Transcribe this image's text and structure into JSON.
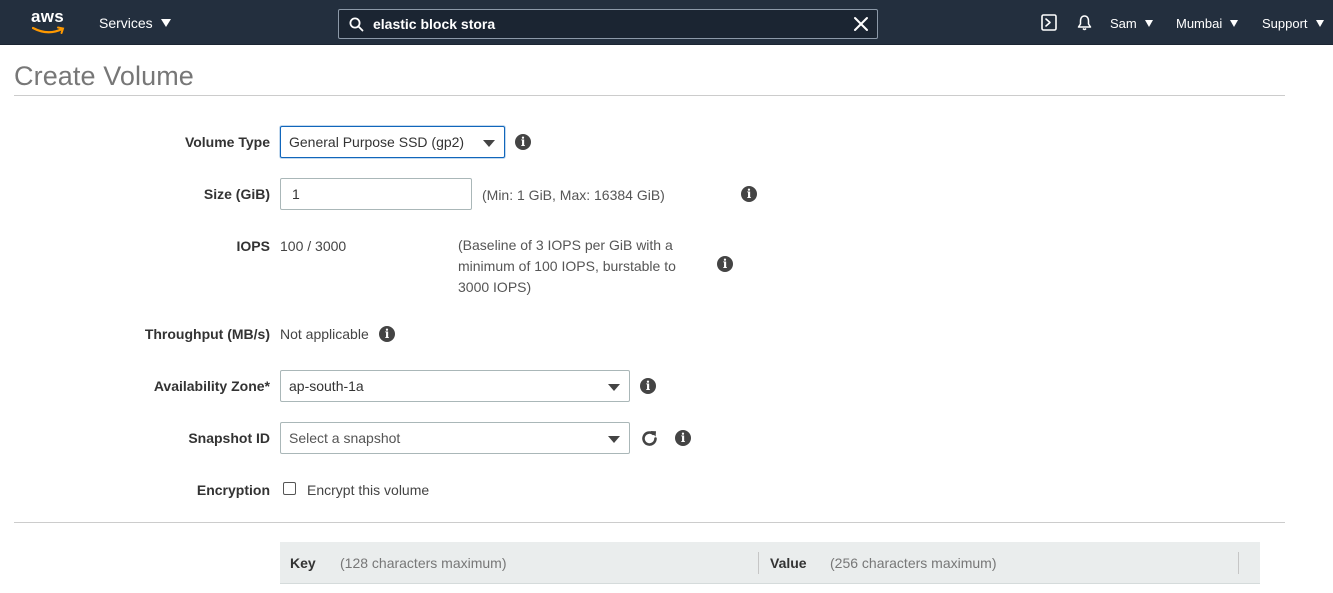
{
  "nav": {
    "logo_text": "aws",
    "services_label": "Services",
    "search": {
      "value": "elastic block stora",
      "placeholder": ""
    },
    "user_label": "Sam",
    "region_label": "Mumbai",
    "support_label": "Support"
  },
  "page": {
    "title": "Create Volume"
  },
  "form": {
    "volume_type": {
      "label": "Volume Type",
      "selected": "General Purpose SSD (gp2)"
    },
    "size": {
      "label": "Size (GiB)",
      "value": "1",
      "hint": "(Min: 1 GiB, Max: 16384 GiB)"
    },
    "iops": {
      "label": "IOPS",
      "value": "100 / 3000",
      "hint_line1": "(Baseline of 3 IOPS per GiB with a",
      "hint_line2": "minimum of 100 IOPS, burstable to",
      "hint_line3": "3000 IOPS)"
    },
    "throughput": {
      "label": "Throughput (MB/s)",
      "value": "Not applicable"
    },
    "availability_zone": {
      "label": "Availability Zone*",
      "selected": "ap-south-1a"
    },
    "snapshot": {
      "label": "Snapshot ID",
      "placeholder": "Select a snapshot"
    },
    "encryption": {
      "label": "Encryption",
      "checkbox_label": "Encrypt this volume",
      "checked": false
    }
  },
  "tags": {
    "key_header": "Key",
    "key_hint": "(128 characters maximum)",
    "value_header": "Value",
    "value_hint": "(256 characters maximum)"
  },
  "colors": {
    "nav_bg": "#232f3e",
    "accent_orange": "#ff9900",
    "focus_blue": "#1166bb"
  },
  "icons": {
    "search": "search-icon",
    "clear": "close-icon",
    "cloudshell": "terminal-icon",
    "notifications": "bell-icon",
    "info": "info-icon",
    "refresh": "refresh-icon"
  }
}
